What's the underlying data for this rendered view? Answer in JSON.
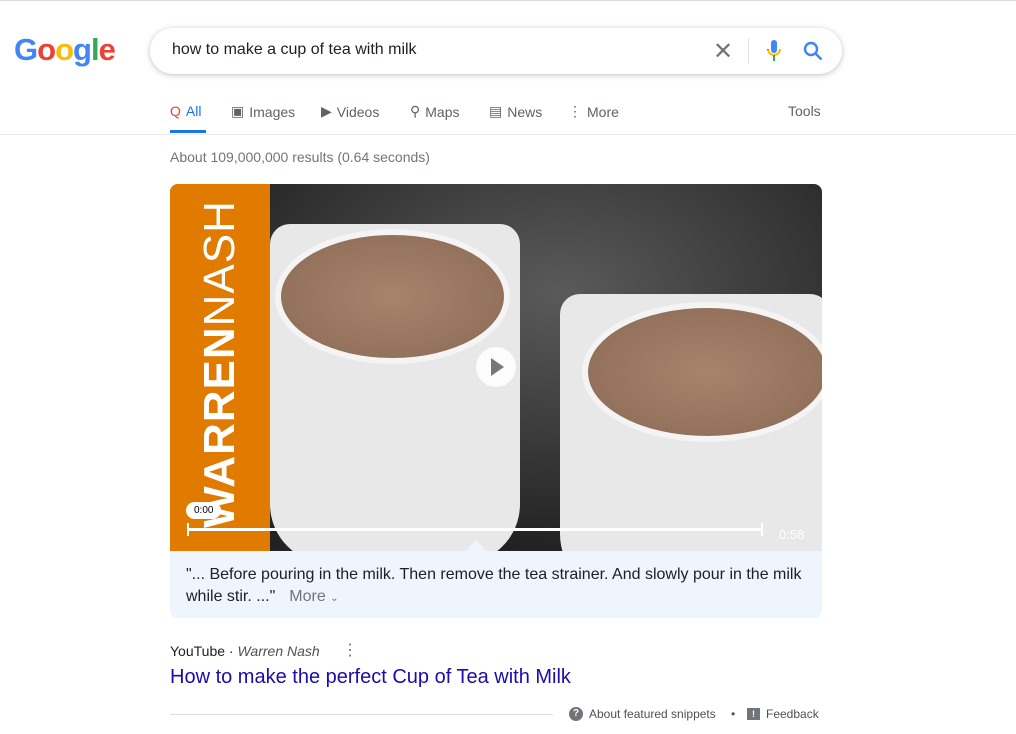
{
  "logo": "Google",
  "search": {
    "query": "how to make a cup of tea with milk"
  },
  "tabs": [
    {
      "label": "All"
    },
    {
      "label": "Images"
    },
    {
      "label": "Videos"
    },
    {
      "label": "Maps"
    },
    {
      "label": "News"
    },
    {
      "label": "More"
    }
  ],
  "tools": "Tools",
  "stats": "About 109,000,000 results (0.64 seconds)",
  "video": {
    "current_time": "0:00",
    "duration": "0:58",
    "progress_percent": 0
  },
  "snippet": {
    "text": "\"... Before pouring in the milk. Then remove the tea strainer. And slowly pour in the milk while stir. ...\"",
    "more": "More"
  },
  "result": {
    "source": "YouTube",
    "author": "Warren Nash",
    "title": "How to make the perfect Cup of Tea with Milk"
  },
  "footer": {
    "about": "About featured snippets",
    "feedback": "Feedback"
  },
  "band_text": "WARREN NASH",
  "colors": {
    "accent": "#1a73e8",
    "link": "#1a0dab",
    "band": "#e07b00"
  }
}
